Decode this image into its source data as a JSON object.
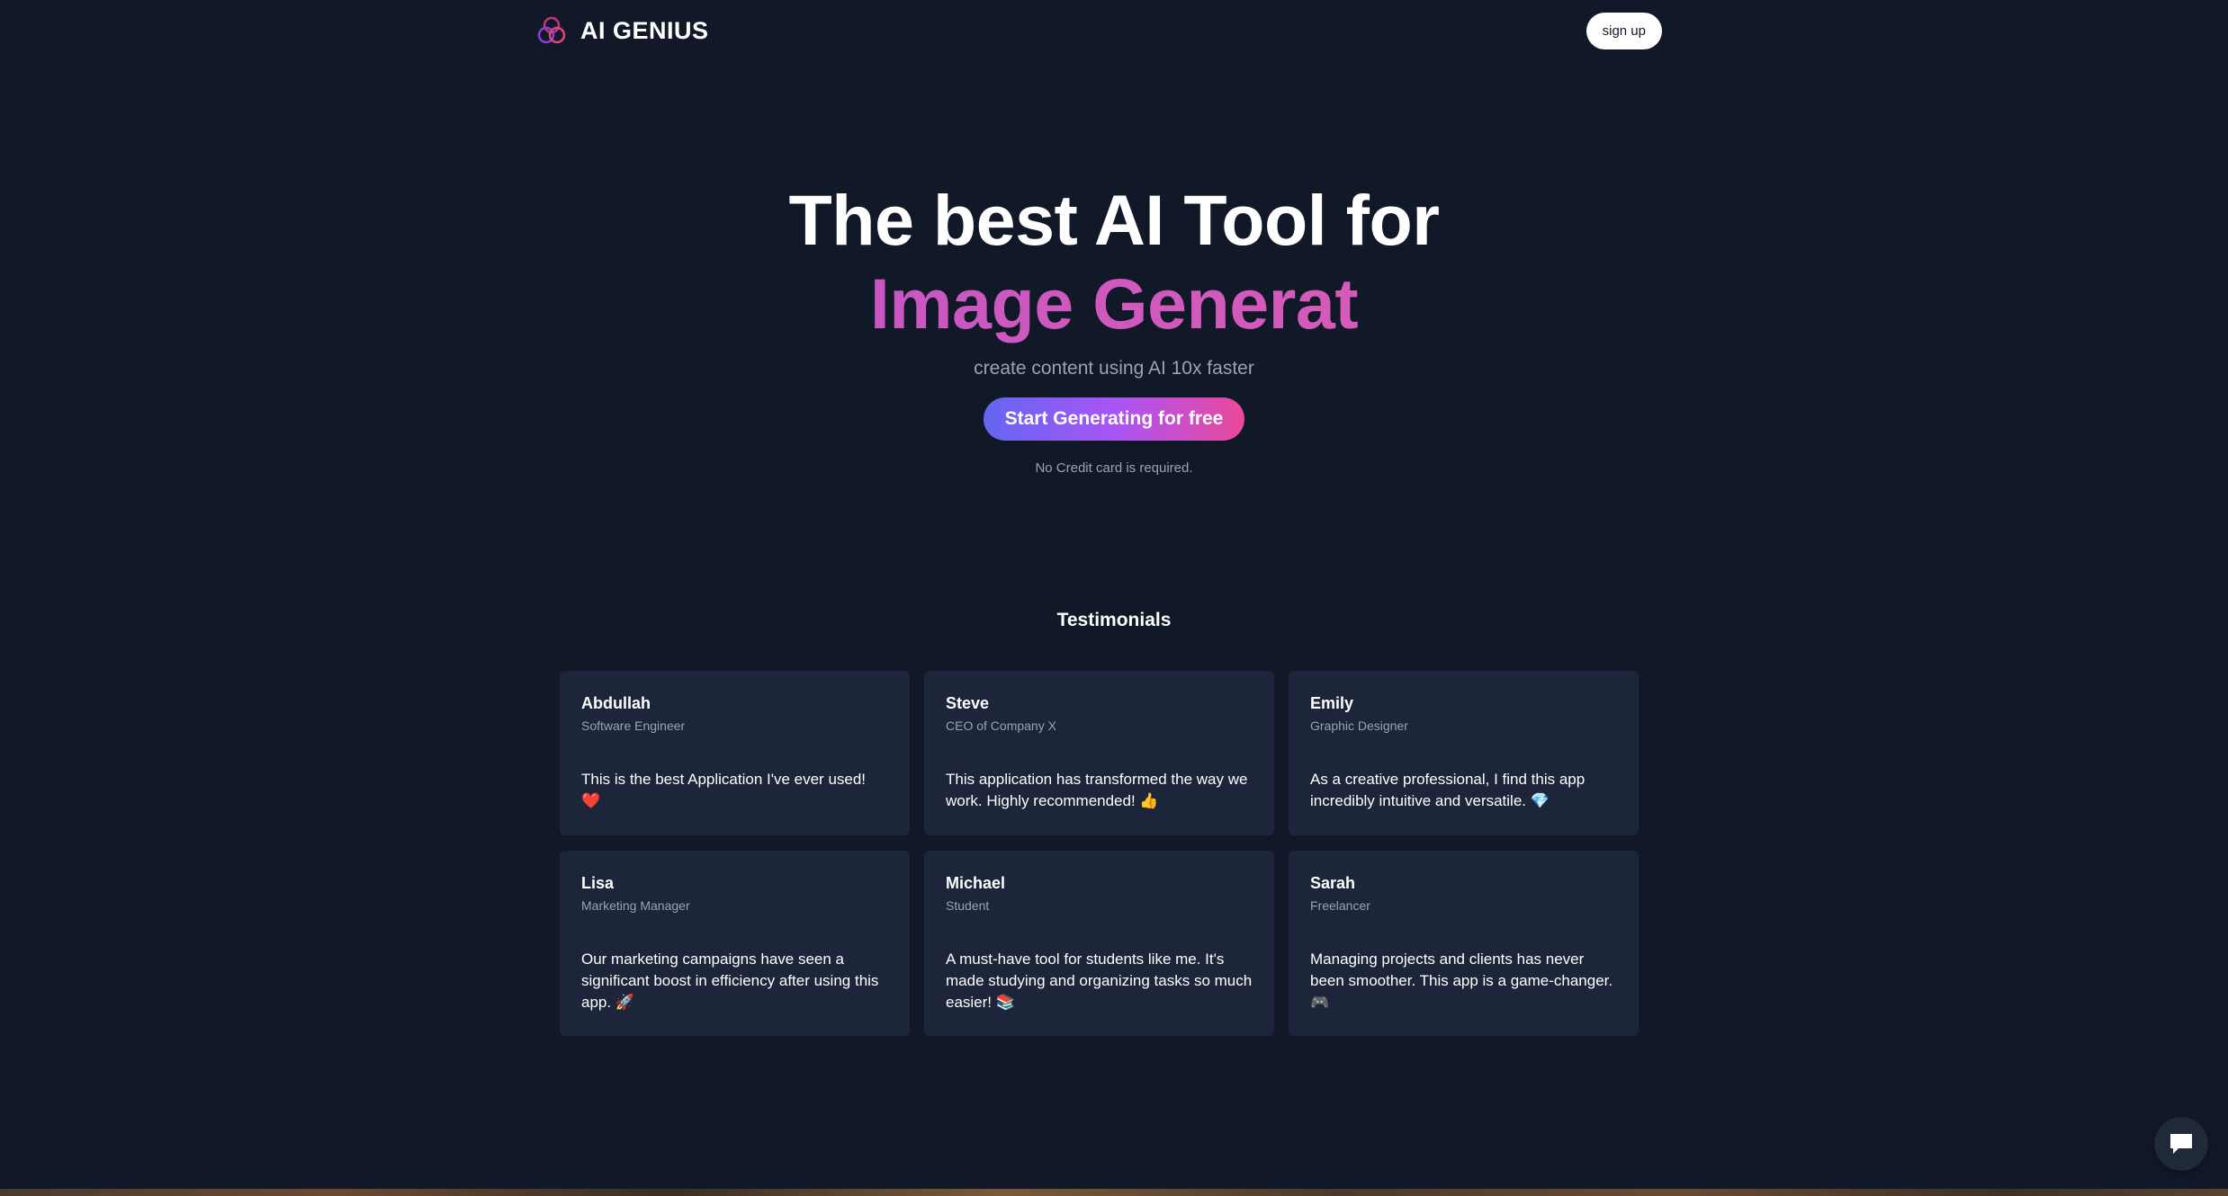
{
  "header": {
    "brand": "AI GENIUS",
    "signup_label": "sign up"
  },
  "hero": {
    "title_line1": "The best AI Tool for",
    "title_line2": "Image Generat",
    "subtitle": "create content using AI 10x faster",
    "cta_label": "Start Generating for free",
    "cta_note": "No Credit card is required."
  },
  "testimonials": {
    "title": "Testimonials",
    "items": [
      {
        "name": "Abdullah",
        "role": "Software Engineer",
        "text": "This is the best Application I've ever used! ❤️"
      },
      {
        "name": "Steve",
        "role": "CEO of Company X",
        "text": "This application has transformed the way we work. Highly recommended! 👍"
      },
      {
        "name": "Emily",
        "role": "Graphic Designer",
        "text": "As a creative professional, I find this app incredibly intuitive and versatile. 💎"
      },
      {
        "name": "Lisa",
        "role": "Marketing Manager",
        "text": "Our marketing campaigns have seen a significant boost in efficiency after using this app. 🚀"
      },
      {
        "name": "Michael",
        "role": "Student",
        "text": "A must-have tool for students like me. It's made studying and organizing tasks so much easier! 📚"
      },
      {
        "name": "Sarah",
        "role": "Freelancer",
        "text": "Managing projects and clients has never been smoother. This app is a game-changer. 🎮"
      }
    ]
  },
  "icons": {
    "brand": "three-circles-logo-icon",
    "chat": "chat-bubble-icon"
  },
  "colors": {
    "background": "#111827",
    "card": "#1c2539",
    "accent_gradient_start": "#6366f1",
    "accent_gradient_end": "#ec4899",
    "title_gradient": "#d55bb8"
  }
}
